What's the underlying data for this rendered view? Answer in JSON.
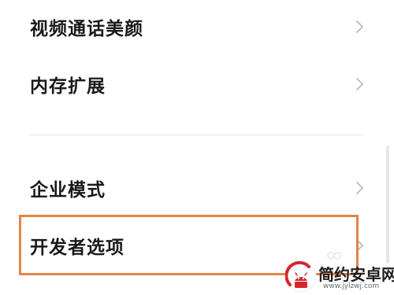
{
  "settings": {
    "items": [
      {
        "label": "视频通话美颜"
      },
      {
        "label": "内存扩展"
      },
      {
        "label": "企业模式"
      },
      {
        "label": "开发者选项"
      }
    ]
  },
  "watermark": {
    "title": "简约安卓网",
    "url": "www.jylzwj.com"
  },
  "colors": {
    "highlight": "#e4834a",
    "text": "#1a1a1a",
    "chevron": "#b9b9b9",
    "watermark_accent": "#d6262d"
  },
  "icons": {
    "chevron": "chevron-right-icon",
    "logo": "android-logo-icon"
  }
}
